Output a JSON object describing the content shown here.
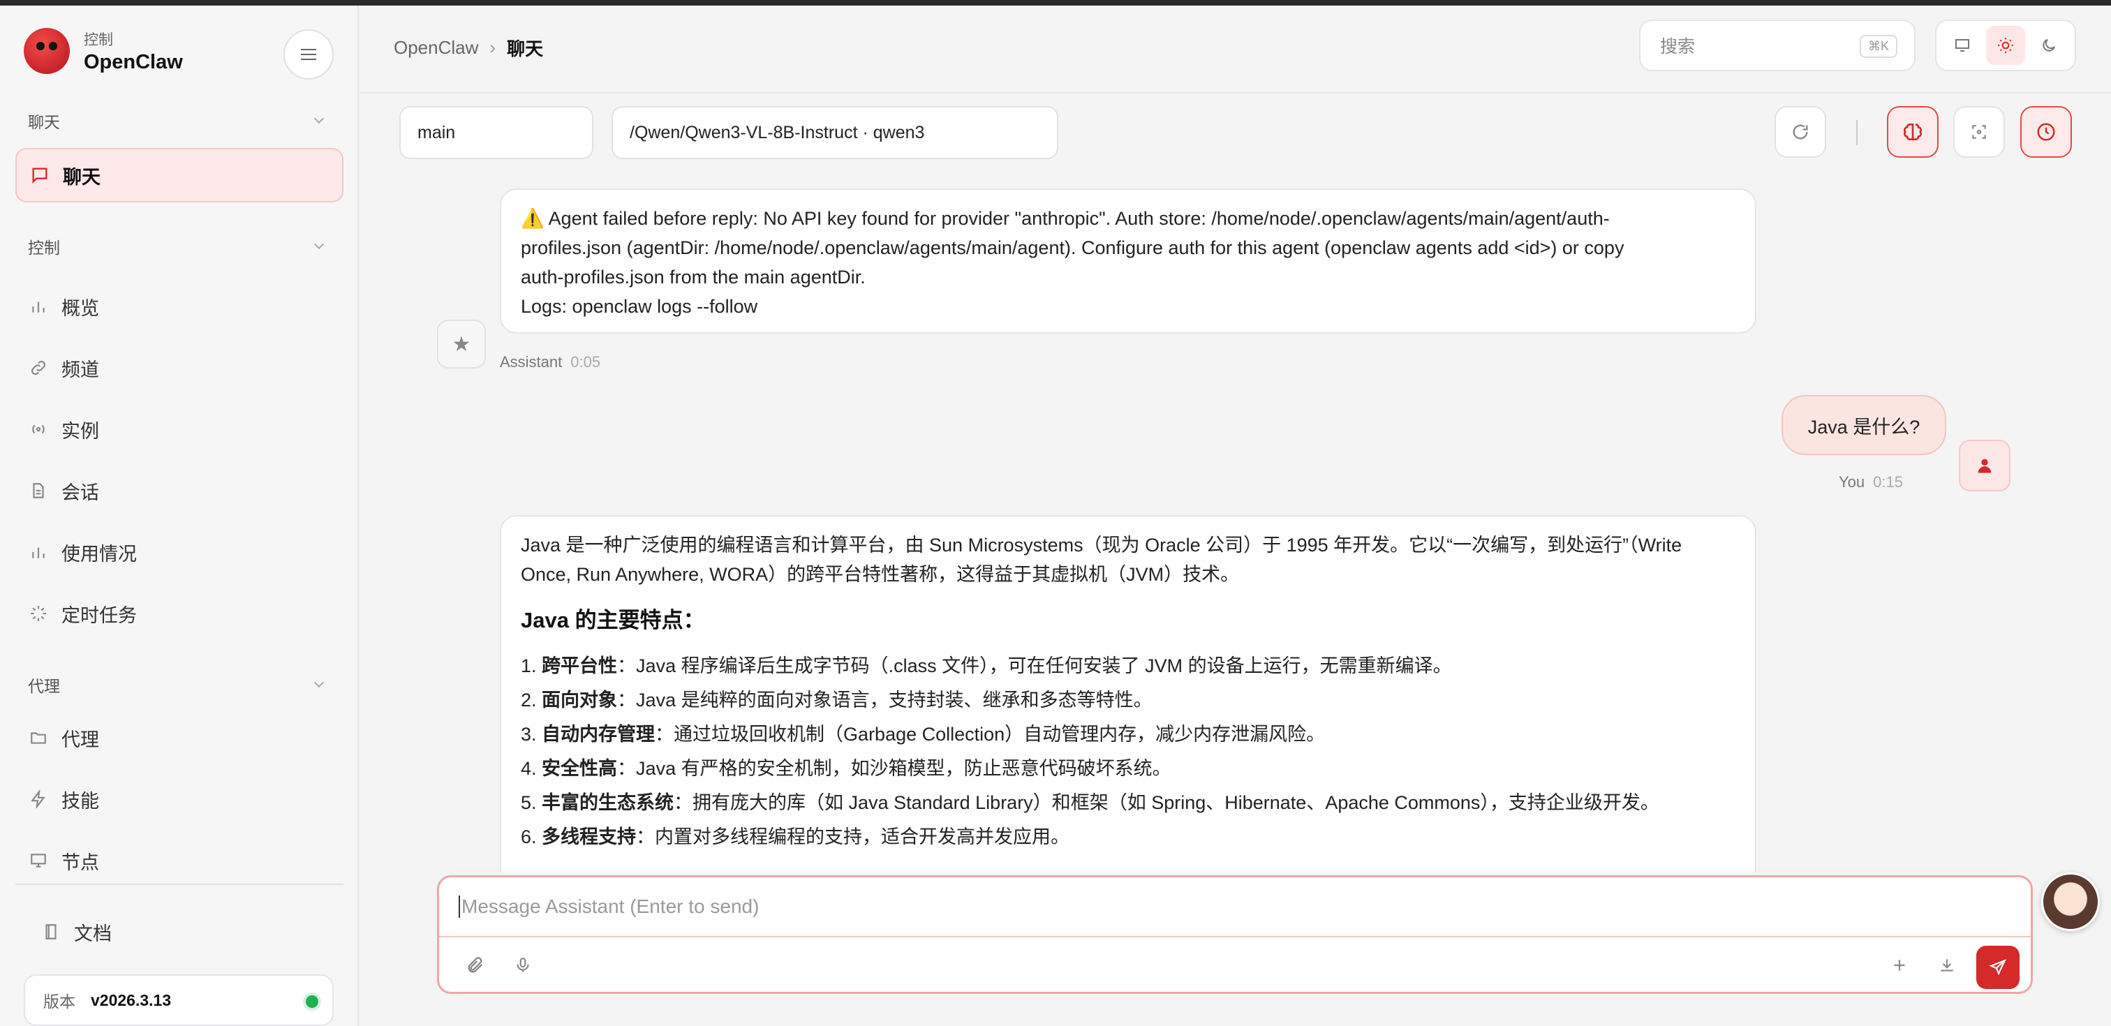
{
  "app": {
    "brand_sub": "控制",
    "brand_name": "OpenClaw"
  },
  "sidebar": {
    "sections": {
      "chat": "聊天",
      "control": "控制",
      "agent": "代理"
    },
    "items": [
      {
        "label": "聊天",
        "icon": "chat-bubble-icon",
        "active": true
      },
      {
        "label": "概览",
        "icon": "bar-chart-icon"
      },
      {
        "label": "频道",
        "icon": "link-icon"
      },
      {
        "label": "实例",
        "icon": "radio-icon"
      },
      {
        "label": "会话",
        "icon": "document-icon"
      },
      {
        "label": "使用情况",
        "icon": "bar-chart-icon"
      },
      {
        "label": "定时任务",
        "icon": "loader-icon"
      },
      {
        "label": "代理",
        "icon": "folder-icon"
      },
      {
        "label": "技能",
        "icon": "lightning-icon"
      },
      {
        "label": "节点",
        "icon": "monitor-icon"
      },
      {
        "label": "文档",
        "icon": "book-icon"
      }
    ],
    "version_label": "版本",
    "version_value": "v2026.3.13"
  },
  "header": {
    "breadcrumb_root": "OpenClaw",
    "breadcrumb_sep": "›",
    "breadcrumb_current": "聊天",
    "search_placeholder": "搜索",
    "search_shortcut": "⌘K",
    "theme_modes": [
      "system",
      "light",
      "dark"
    ],
    "theme_selected": "light"
  },
  "toolbar": {
    "session": "main",
    "model": "/Qwen/Qwen3-VL-8B-Instruct · qwen3"
  },
  "messages": {
    "error": {
      "lines": [
        "⚠️ Agent failed before reply: No API key found for provider \"anthropic\". Auth store: /home/node/.openclaw/agents/main/agent/auth-",
        "profiles.json (agentDir: /home/node/.openclaw/agents/main/agent). Configure auth for this agent (openclaw agents add <id>) or copy",
        "auth-profiles.json from the main agentDir.",
        "Logs: openclaw logs --follow"
      ],
      "sender": "Assistant",
      "time": "0:05"
    },
    "user": {
      "text": "Java 是什么?",
      "sender": "You",
      "time": "0:15"
    },
    "answer": {
      "intro_1": "Java 是一种广泛使用的编程语言和计算平台，由 Sun Microsystems（现为 Oracle 公司）于 1995 年开发。它以“一次编写，到处运行”（Write",
      "intro_2": "Once, Run Anywhere, WORA）的跨平台特性著称，这得益于其虚拟机（JVM）技术。",
      "heading": "Java 的主要特点：",
      "items": [
        {
          "num": "1.",
          "title": "跨平台性",
          "text": "：Java 程序编译后生成字节码（.class 文件），可在任何安装了 JVM 的设备上运行，无需重新编译。"
        },
        {
          "num": "2.",
          "title": "面向对象",
          "text": "：Java 是纯粹的面向对象语言，支持封装、继承和多态等特性。"
        },
        {
          "num": "3.",
          "title": "自动内存管理",
          "text": "：通过垃圾回收机制（Garbage Collection）自动管理内存，减少内存泄漏风险。"
        },
        {
          "num": "4.",
          "title": "安全性高",
          "text": "：Java 有严格的安全机制，如沙箱模型，防止恶意代码破坏系统。"
        },
        {
          "num": "5.",
          "title": "丰富的生态系统",
          "text": "：拥有庞大的库（如 Java Standard Library）和框架（如 Spring、Hibernate、Apache Commons），支持企业级开发。"
        },
        {
          "num": "6.",
          "title": "多线程支持",
          "text": "：内置对多线程编程的支持，适合开发高并发应用。"
        }
      ]
    }
  },
  "composer": {
    "placeholder": "Message Assistant (Enter to send)"
  },
  "colors": {
    "accent": "#d42a2a",
    "accent_soft": "#fde9e9",
    "status_ok": "#1fb14b"
  }
}
